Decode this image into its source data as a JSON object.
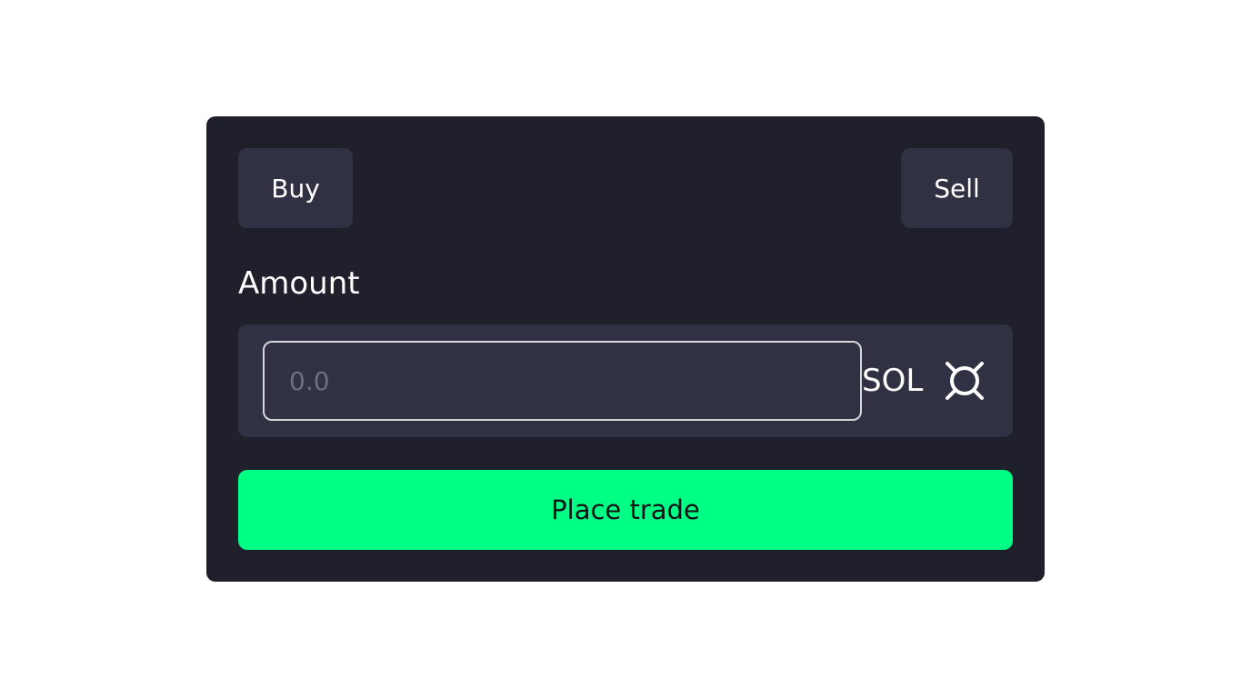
{
  "trade": {
    "buy_label": "Buy",
    "sell_label": "Sell",
    "amount_label": "Amount",
    "amount_value": "",
    "amount_placeholder": "0.0",
    "unit": "SOL",
    "unit_icon": "currency-icon",
    "submit_label": "Place trade"
  },
  "colors": {
    "page_background": "#ffffff",
    "card_background": "#20202c",
    "control_background": "#303143",
    "accent": "#00ff85",
    "text": "#ffffff"
  }
}
